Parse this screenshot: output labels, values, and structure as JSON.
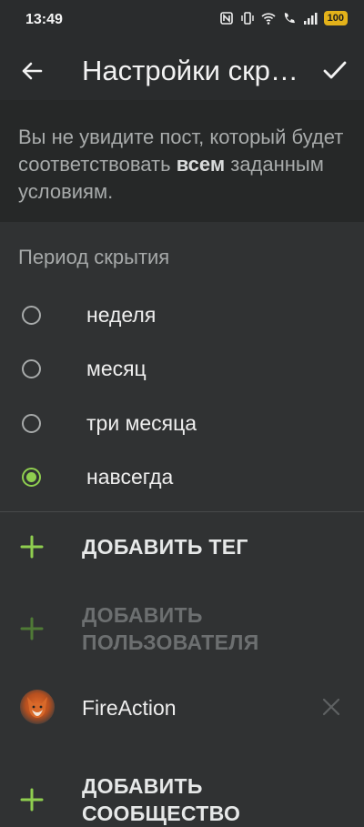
{
  "status_bar": {
    "time": "13:49",
    "battery": "100",
    "icons": [
      "nfc-icon",
      "vibrate-icon",
      "wifi-icon",
      "wifi-call-icon",
      "signal-icon",
      "battery-icon"
    ]
  },
  "app_bar": {
    "title": "Настройки скрытия",
    "back_icon": "arrow-back-icon",
    "confirm_icon": "check-icon"
  },
  "info": {
    "text_before": "Вы не увидите пост, который будет соответствовать ",
    "text_bold": "всем",
    "text_after": " заданным условиям."
  },
  "period": {
    "title": "Период скрытия",
    "options": [
      {
        "label": "неделя",
        "selected": false
      },
      {
        "label": "месяц",
        "selected": false
      },
      {
        "label": "три месяца",
        "selected": false
      },
      {
        "label": "навсегда",
        "selected": true
      }
    ]
  },
  "actions": {
    "add_tag": "ДОБАВИТЬ ТЕГ",
    "add_user_line1": "ДОБАВИТЬ",
    "add_user_line2": "ПОЛЬЗОВАТЕЛЯ",
    "add_community_line1": "ДОБАВИТЬ",
    "add_community_line2": "СООБЩЕСТВО"
  },
  "users": [
    {
      "name": "FireAction"
    }
  ],
  "colors": {
    "accent": "#8fce4f",
    "background": "#303233",
    "bar": "#2a2c2d",
    "info_bg": "#262828",
    "battery": "#e3b21a"
  }
}
